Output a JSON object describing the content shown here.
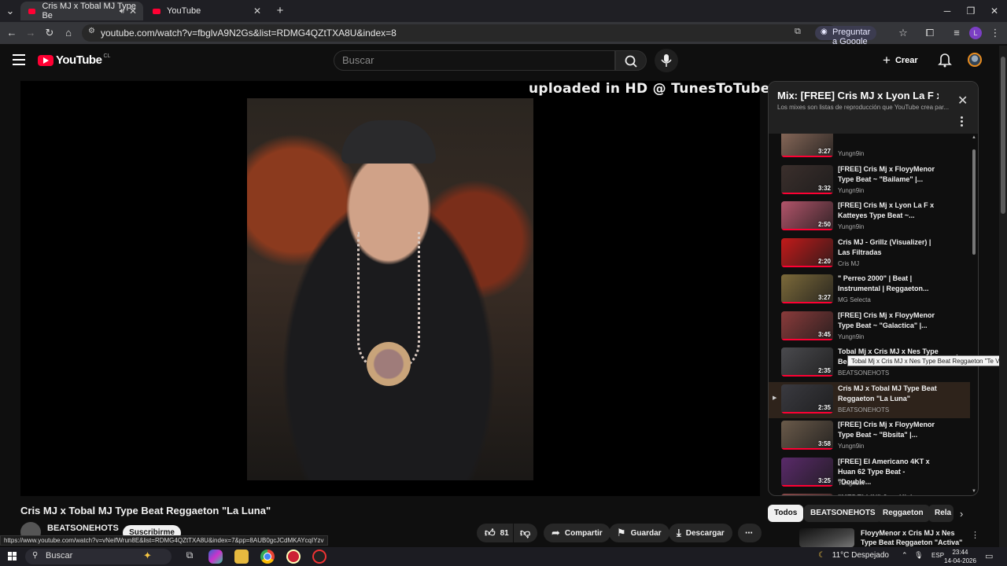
{
  "browser": {
    "tabs": [
      {
        "label": "Cris MJ x Tobal MJ Type Be",
        "active": true
      },
      {
        "label": "YouTube",
        "active": false
      }
    ],
    "url": "youtube.com/watch?v=fbglvA9N2Gs&list=RDMG4QZtTXA8U&index=8",
    "ask_google": "Preguntar a Google",
    "new_tab": "+"
  },
  "header": {
    "logo_text": "YouTube",
    "country_code": "CL",
    "search_placeholder": "Buscar",
    "create_label": "Crear"
  },
  "video": {
    "watermark": "uploaded in HD @ TunesToTube.com",
    "title": "Cris MJ x Tobal MJ Type Beat Reggaeton \"La Luna\"",
    "channel": "BEATSONEHOTS",
    "subscribe_label": "Suscribirme",
    "likes": "81",
    "share_label": "Compartir",
    "save_label": "Guardar",
    "download_label": "Descargar"
  },
  "status_url": "https://www.youtube.com/watch?v=vNeifWrun8E&list=RDMG4QZtTXA8U&index=7&pp=8AUB0gcJCdMKAYcqIYzv",
  "playlist": {
    "title": "Mix: [FREE] Cris MJ x Lyon La F x...",
    "subtitle": "Los mixes son listas de reproducción que YouTube crea par...",
    "items": [
      {
        "title": "",
        "channel": "Yungn9in",
        "duration": "3:27",
        "current": false,
        "color": "#8a6a5a"
      },
      {
        "title": "[FREE] Cris Mj x FloyyMenor Type Beat ~ \"Bailame\" |...",
        "channel": "Yungn9in",
        "duration": "3:32",
        "current": false,
        "color": "#3b2f2c"
      },
      {
        "title": "[FREE] Cris Mj x Lyon La F x Katteyes Type Beat ~...",
        "channel": "Yungn9in",
        "duration": "2:50",
        "current": false,
        "color": "#b2546a"
      },
      {
        "title": "Cris MJ - Grillz (Visualizer) | Las Filtradas",
        "channel": "Cris MJ",
        "duration": "2:20",
        "current": false,
        "color": "#c21a1a"
      },
      {
        "title": "\" Perreo 2000\" | Beat | Instrumental | Reggaeton...",
        "channel": "MG Selecta",
        "duration": "3:27",
        "current": false,
        "color": "#7c6a3a"
      },
      {
        "title": "[FREE] Cris Mj x FloyyMenor Type Beat ~ \"Galactica\" |...",
        "channel": "Yungn9in",
        "duration": "3:45",
        "current": false,
        "color": "#8a3b3b"
      },
      {
        "title": "Tobal Mj x Cris MJ x Nes Type Beat Reggaeton \"Te Vas\"",
        "channel": "BEATSONEHOTS",
        "duration": "2:35",
        "current": false,
        "color": "#4a4a4e"
      },
      {
        "title": "Cris MJ x Tobal MJ Type Beat Reggaeton \"La Luna\"",
        "channel": "BEATSONEHOTS",
        "duration": "2:35",
        "current": true,
        "color": "#3a3a40"
      },
      {
        "title": "[FREE] Cris Mj x FloyyMenor Type Beat ~ \"Bbsita\" |...",
        "channel": "Yungn9in",
        "duration": "3:58",
        "current": false,
        "color": "#6a5a4a"
      },
      {
        "title": "[FREE] El Americano 4KT x Huan 62 Type Beat - \"Double...",
        "channel": "Yungn9in",
        "duration": "3:25",
        "current": false,
        "color": "#5a2a6a"
      },
      {
        "title": "\"MEDELLIN\" Jere Klein x Jairo Vera Type Beat Reggaeton...",
        "channel": "",
        "duration": "",
        "current": false,
        "color": "#8a4a4a"
      }
    ],
    "tooltip": "Tobal Mj x Cris MJ x Nes Type Beat Reggaeton \"Te Vas\""
  },
  "chips": [
    "Todos",
    "BEATSONEHOTS",
    "Reggaeton",
    "Rela"
  ],
  "recommendation": {
    "title": "FloyyMenor x Cris MJ x Nes Type Beat Reggaeton \"Activa\""
  },
  "taskbar": {
    "search_label": "Buscar",
    "weather": "11°C  Despejado",
    "lang": "ESP",
    "time": "23:44",
    "date": "14-04-2026"
  },
  "colors": {
    "brand": "#ff0033",
    "background": "#0f0f0f",
    "current_item": "#2e231b"
  }
}
